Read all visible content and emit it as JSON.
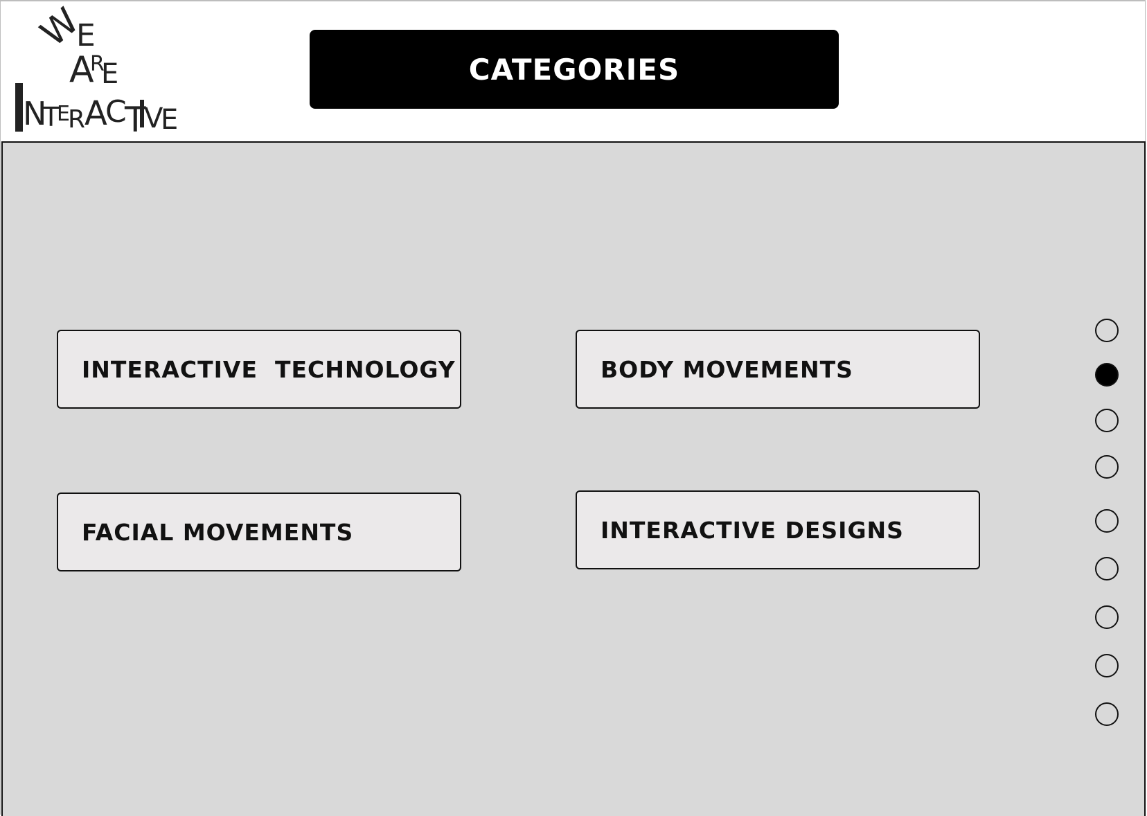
{
  "logo": {
    "lines": [
      "WE",
      "ARE",
      "INTERACTIVE"
    ]
  },
  "header": {
    "title": "CATEGORIES",
    "bar_color": "#000000"
  },
  "categories": [
    {
      "label": "INTERACTIVE  TECHNOLOGY"
    },
    {
      "label": "BODY MOVEMENTS"
    },
    {
      "label": "FACIAL MOVEMENTS"
    },
    {
      "label": "INTERACTIVE DESIGNS"
    }
  ],
  "pagination": {
    "total": 9,
    "active_index": 1
  },
  "colors": {
    "panel_bg": "#d9d9d9",
    "button_bg": "#ebe9ea",
    "text": "#111111"
  }
}
